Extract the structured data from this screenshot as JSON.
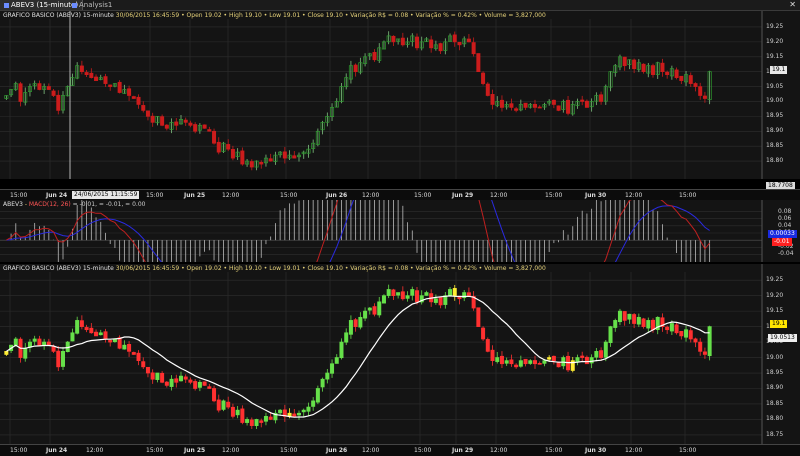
{
  "tabs": [
    {
      "label": "ABEV3 (15-minute)",
      "active": true
    },
    {
      "label": "Analysis1",
      "active": false
    }
  ],
  "colors": {
    "bull": "#2f9e2f",
    "bull_bright": "#66e04a",
    "bear": "#cc1c1c",
    "bear_bright": "#ff3030",
    "yellow": "#ffee33",
    "ma": "#ffffff",
    "macd": "#c02020",
    "signal": "#2a2ae0",
    "grid": "#2e2e2e",
    "last_tag": "#e8e8e8",
    "macd_tag": "#1a2adf",
    "yellow_tag": "#ffe600"
  },
  "top_pane": {
    "info_symbol": "GRAFICO BASICO (ABEV3) 15-minute",
    "info_text": "30/06/2015 16:45:59  • Open 19.02  • High 19.10  • Low 19.01  • Close 19.10  • Variação R$ = 0.08  • Variação % = 0.42%  • Volume = 3,827,000",
    "y_ticks": [
      "19.25",
      "19.20",
      "19.15",
      "19.10",
      "19.05",
      "19.00",
      "18.95",
      "18.90",
      "18.85",
      "18.80"
    ],
    "last_price_tag": "19.1",
    "crosshair_price_tag": "18.7708"
  },
  "macd_pane": {
    "info_symbol": "ABEV3",
    "info_macd": "MACD(12, 26)",
    "info_values": "= -0.01,  = -0.01,  = 0.00",
    "y_ticks": [
      "0.08",
      "0.06",
      "0.04",
      "0.02",
      "-0.02",
      "-0.04"
    ],
    "macd_tag": "0.00033",
    "red_tag": "-0.01"
  },
  "bottom_pane": {
    "info_symbol": "GRAFICO BASICO (ABEV3) 15-minute",
    "info_text": "30/06/2015 16:45:59  • Open 19.02  • High 19.10  • Low 19.01  • Close 19.10  • Variação R$ = 0.08  • Variação % = 0.42%  • Volume = 3,827,000",
    "y_ticks": [
      "19.25",
      "19.20",
      "19.15",
      "19.10",
      "19.05",
      "19.00",
      "18.95",
      "18.90",
      "18.85",
      "18.80",
      "18.75"
    ],
    "last_price_tag": "19.1",
    "ma_tag": "19.0513"
  },
  "top_x_axis": [
    "15:00",
    "Jun 24",
    "24/06/2015 11:15:59",
    "15:00",
    "Jun 25",
    "12:00",
    "15:00",
    "Jun 26",
    "12:00",
    "15:00",
    "Jun 29",
    "12:00",
    "15:00",
    "Jun 30",
    "12:00",
    "15:00"
  ],
  "bottom_x_axis": [
    "15:00",
    "Jun 24",
    "12:00",
    "15:00",
    "Jun 25",
    "12:00",
    "15:00",
    "Jun 26",
    "12:00",
    "15:00",
    "Jun 29",
    "12:00",
    "15:00",
    "Jun 30",
    "12:00",
    "15:00"
  ],
  "chart_data": {
    "type": "candlestick",
    "title": "GRAFICO BASICO (ABEV3) 15-minute",
    "y_range": [
      18.75,
      19.27
    ],
    "close": [
      19.02,
      19.04,
      19.06,
      19.0,
      19.03,
      19.05,
      19.06,
      19.04,
      19.05,
      19.04,
      19.02,
      18.97,
      19.02,
      19.05,
      19.08,
      19.12,
      19.1,
      19.09,
      19.08,
      19.07,
      19.08,
      19.06,
      19.05,
      19.06,
      19.03,
      19.04,
      19.02,
      19.01,
      18.99,
      18.97,
      18.95,
      18.93,
      18.95,
      18.92,
      18.91,
      18.93,
      18.92,
      18.94,
      18.93,
      18.92,
      18.9,
      18.92,
      18.91,
      18.9,
      18.86,
      18.83,
      18.86,
      18.84,
      18.81,
      18.83,
      18.79,
      18.8,
      18.78,
      18.8,
      18.79,
      18.81,
      18.8,
      18.82,
      18.83,
      18.81,
      18.82,
      18.81,
      18.82,
      18.83,
      18.84,
      18.86,
      18.9,
      18.93,
      18.95,
      18.98,
      19.0,
      19.05,
      19.08,
      19.12,
      19.1,
      19.13,
      19.15,
      19.16,
      19.14,
      19.18,
      19.2,
      19.22,
      19.2,
      19.21,
      19.19,
      19.2,
      19.22,
      19.18,
      19.2,
      19.21,
      19.18,
      19.19,
      19.17,
      19.2,
      19.22,
      19.2,
      19.19,
      19.21,
      19.2,
      19.16,
      19.1,
      19.06,
      19.02,
      18.99,
      19.0,
      18.98,
      18.99,
      18.98,
      18.97,
      18.99,
      18.98,
      18.99,
      18.98,
      18.98,
      18.99,
      19.0,
      18.99,
      18.97,
      19.0,
      18.96,
      18.99,
      19.0,
      19.0,
      18.98,
      19.0,
      19.02,
      19.0,
      19.05,
      19.1,
      19.12,
      19.15,
      19.12,
      19.14,
      19.11,
      19.13,
      19.1,
      19.12,
      19.09,
      19.13,
      19.1,
      19.09,
      19.11,
      19.08,
      19.07,
      19.09,
      19.06,
      19.05,
      19.02,
      19.01,
      19.1
    ],
    "ma_note": "white moving average overlay in lower pane",
    "macd_range": [
      -0.05,
      0.09
    ]
  }
}
